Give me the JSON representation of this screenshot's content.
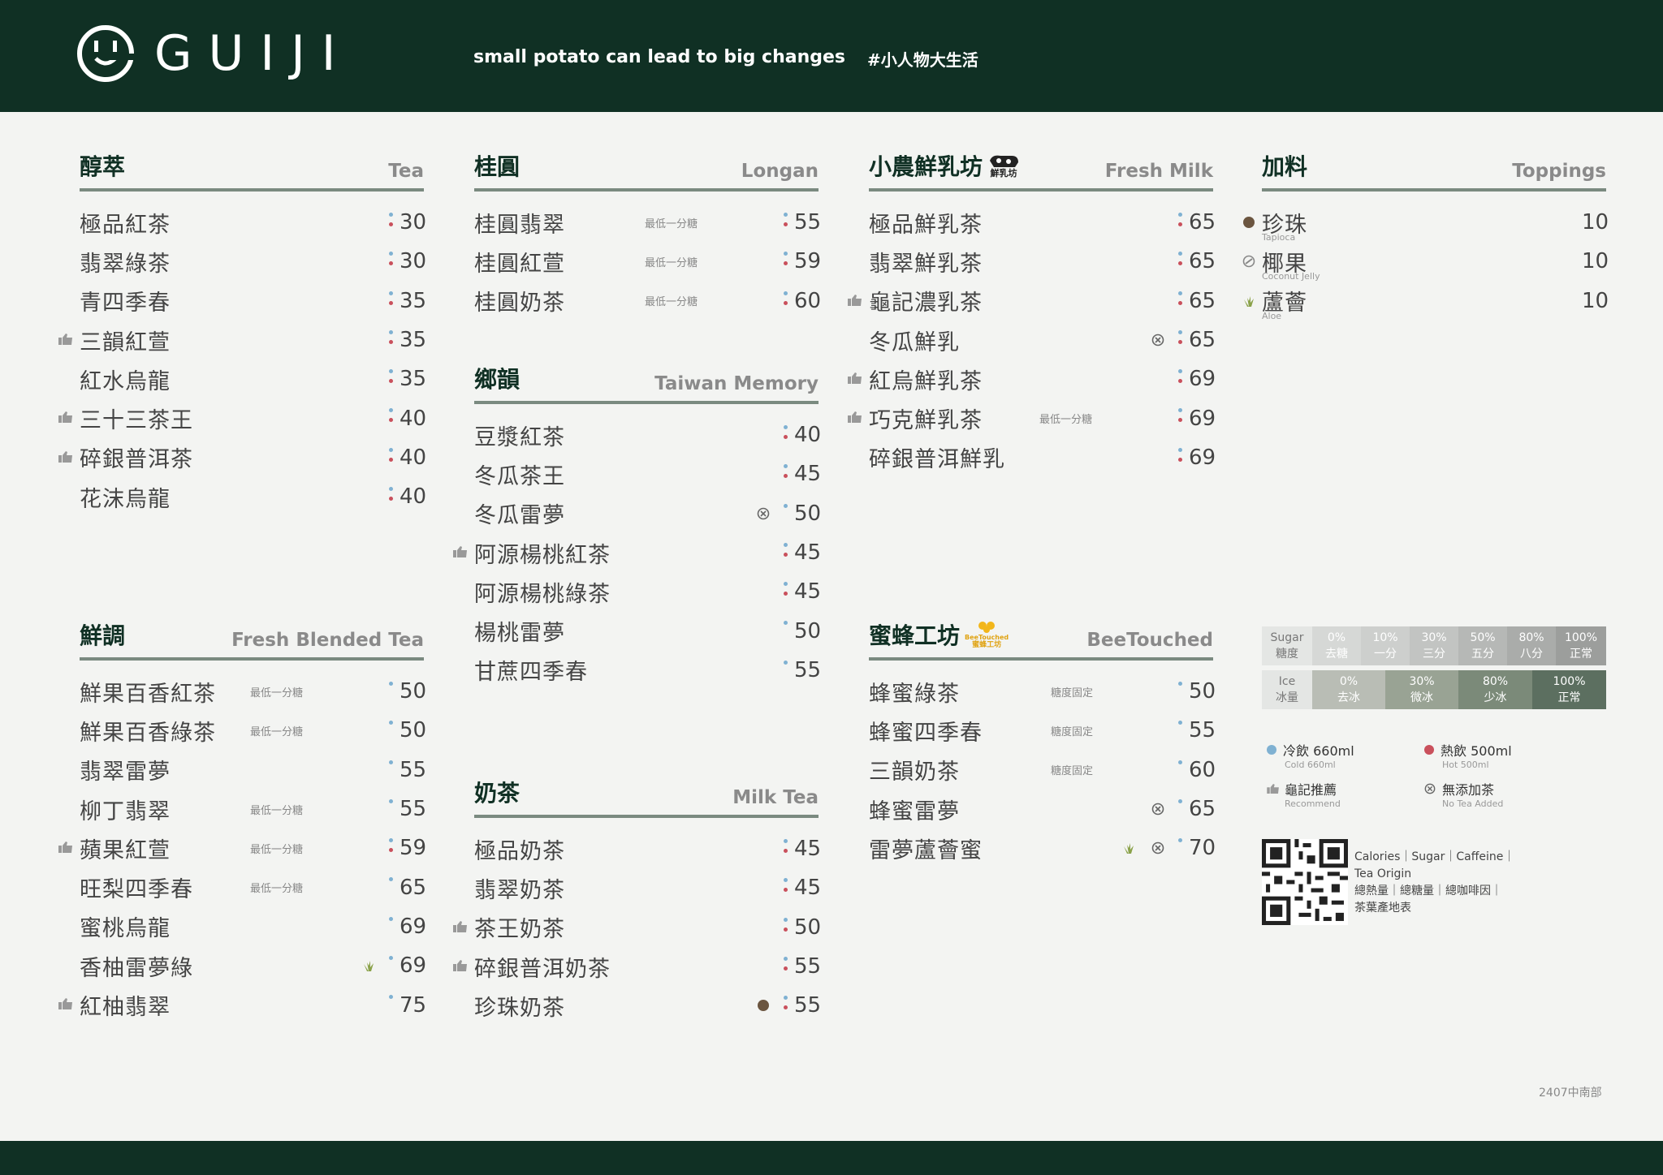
{
  "header": {
    "brand": "GUIJI",
    "slogan": "small potato can lead to big changes",
    "hashtag": "#小人物大生活"
  },
  "sections": {
    "tea": {
      "zh": "醇萃",
      "en": "Tea",
      "items": [
        {
          "name": "極品紅茶",
          "price": "30"
        },
        {
          "name": "翡翠綠茶",
          "price": "30"
        },
        {
          "name": "青四季春",
          "price": "35"
        },
        {
          "name": "三韻紅萱",
          "price": "35"
        },
        {
          "name": "紅水烏龍",
          "price": "35"
        },
        {
          "name": "三十三茶王",
          "price": "40"
        },
        {
          "name": "碎銀普洱茶",
          "price": "40"
        },
        {
          "name": "花沫烏龍",
          "price": "40"
        }
      ]
    },
    "longan": {
      "zh": "桂圓",
      "en": "Longan",
      "items": [
        {
          "name": "桂圓翡翠",
          "note": "最低一分糖",
          "price": "55"
        },
        {
          "name": "桂圓紅萱",
          "note": "最低一分糖",
          "price": "59"
        },
        {
          "name": "桂圓奶茶",
          "note": "最低一分糖",
          "price": "60"
        }
      ]
    },
    "taiwan": {
      "zh": "鄉韻",
      "en": "Taiwan Memory",
      "items": [
        {
          "name": "豆漿紅茶",
          "price": "40"
        },
        {
          "name": "冬瓜茶王",
          "price": "45"
        },
        {
          "name": "冬瓜雷夢",
          "price": "50"
        },
        {
          "name": "阿源楊桃紅茶",
          "price": "45"
        },
        {
          "name": "阿源楊桃綠茶",
          "price": "45"
        },
        {
          "name": "楊桃雷夢",
          "price": "50"
        },
        {
          "name": "甘蔗四季春",
          "price": "55"
        }
      ]
    },
    "milktea": {
      "zh": "奶茶",
      "en": "Milk Tea",
      "items": [
        {
          "name": "極品奶茶",
          "price": "45"
        },
        {
          "name": "翡翠奶茶",
          "price": "45"
        },
        {
          "name": "茶王奶茶",
          "price": "50"
        },
        {
          "name": "碎銀普洱奶茶",
          "price": "55"
        },
        {
          "name": "珍珠奶茶",
          "price": "55"
        }
      ]
    },
    "freshmilk": {
      "zh": "小農鮮乳坊",
      "badge": "鮮乳坊",
      "en": "Fresh Milk",
      "items": [
        {
          "name": "極品鮮乳茶",
          "price": "65"
        },
        {
          "name": "翡翠鮮乳茶",
          "price": "65"
        },
        {
          "name": "龜記濃乳茶",
          "price": "65"
        },
        {
          "name": "冬瓜鮮乳",
          "price": "65"
        },
        {
          "name": "紅烏鮮乳茶",
          "price": "69"
        },
        {
          "name": "巧克鮮乳茶",
          "note": "最低一分糖",
          "price": "69"
        },
        {
          "name": "碎銀普洱鮮乳",
          "price": "69"
        }
      ]
    },
    "toppings": {
      "zh": "加料",
      "en": "Toppings",
      "items": [
        {
          "name": "珍珠",
          "sub": "Tapioca",
          "price": "10"
        },
        {
          "name": "椰果",
          "sub": "Coconut Jelly",
          "price": "10"
        },
        {
          "name": "蘆薈",
          "sub": "Aloe",
          "price": "10"
        }
      ]
    },
    "blended": {
      "zh": "鮮調",
      "en": "Fresh Blended Tea",
      "items": [
        {
          "name": "鮮果百香紅茶",
          "note": "最低一分糖",
          "price": "50"
        },
        {
          "name": "鮮果百香綠茶",
          "note": "最低一分糖",
          "price": "50"
        },
        {
          "name": "翡翠雷夢",
          "price": "55"
        },
        {
          "name": "柳丁翡翠",
          "note": "最低一分糖",
          "price": "55"
        },
        {
          "name": "蘋果紅萱",
          "note": "最低一分糖",
          "price": "59"
        },
        {
          "name": "旺梨四季春",
          "note": "最低一分糖",
          "price": "65"
        },
        {
          "name": "蜜桃烏龍",
          "price": "69"
        },
        {
          "name": "香柚雷夢綠",
          "price": "69"
        },
        {
          "name": "紅柚翡翠",
          "price": "75"
        }
      ]
    },
    "bee": {
      "zh": "蜜蜂工坊",
      "badge_en": "BeeTouched",
      "badge_zh": "蜜蜂工坊",
      "en": "BeeTouched",
      "items": [
        {
          "name": "蜂蜜綠茶",
          "note": "糖度固定",
          "price": "50"
        },
        {
          "name": "蜂蜜四季春",
          "note": "糖度固定",
          "price": "55"
        },
        {
          "name": "三韻奶茶",
          "note": "糖度固定",
          "price": "60"
        },
        {
          "name": "蜂蜜雷夢",
          "price": "65"
        },
        {
          "name": "雷夢蘆薈蜜",
          "price": "70"
        }
      ]
    }
  },
  "legend": {
    "sugar": {
      "en": "Sugar",
      "zh": "糖度",
      "levels": [
        {
          "pct": "0%",
          "zh": "去糖"
        },
        {
          "pct": "10%",
          "zh": "一分"
        },
        {
          "pct": "30%",
          "zh": "三分"
        },
        {
          "pct": "50%",
          "zh": "五分"
        },
        {
          "pct": "80%",
          "zh": "八分"
        },
        {
          "pct": "100%",
          "zh": "正常"
        }
      ]
    },
    "ice": {
      "en": "Ice",
      "zh": "冰量",
      "levels": [
        {
          "pct": "0%",
          "zh": "去冰"
        },
        {
          "pct": "30%",
          "zh": "微冰"
        },
        {
          "pct": "80%",
          "zh": "少冰"
        },
        {
          "pct": "100%",
          "zh": "正常"
        }
      ]
    },
    "cold": {
      "main": "冷飲 660ml",
      "sub": "Cold 660ml"
    },
    "hot": {
      "main": "熱飲 500ml",
      "sub": "Hot 500ml"
    },
    "recommend": {
      "main": "龜記推薦",
      "sub": "Recommend"
    },
    "notea": {
      "main": "無添加茶",
      "sub": "No Tea Added"
    },
    "qr_en_1": "Calories｜Sugar｜Caffeine｜",
    "qr_en_2": "Tea Origin",
    "qr_zh_1": "總熱量｜總糖量｜總咖啡因｜",
    "qr_zh_2": "茶葉產地表"
  },
  "code": "2407中南部",
  "colors": {
    "brand": "#103024",
    "cold": "#7fb1d2",
    "hot": "#c9505c"
  }
}
